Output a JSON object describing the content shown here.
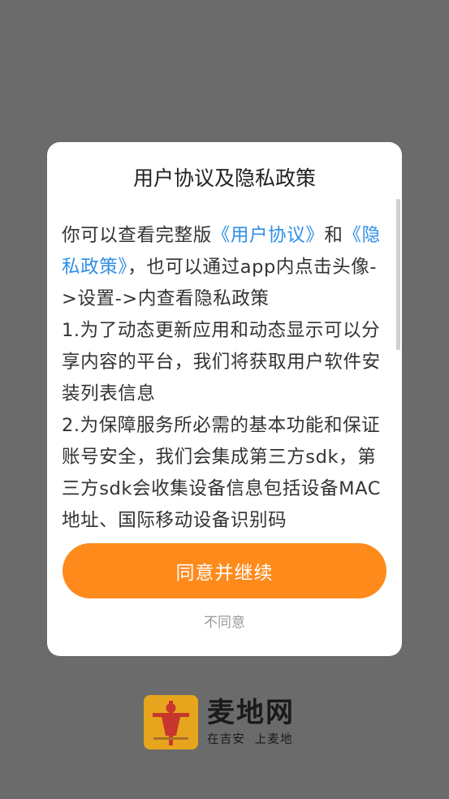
{
  "dialog": {
    "title": "用户协议及隐私政策",
    "intro": {
      "prefix": "你可以查看完整版",
      "user_agreement_link": "《用户协议》",
      "connector": "和",
      "privacy_policy_link": "《隐私政策》",
      "suffix": "，也可以通过app内点击头像->设置->内查看隐私政策"
    },
    "item_1": "1.为了动态更新应用和动态显示可以分享内容的平台，我们将获取用户软件安装列表信息",
    "item_2": "2.为保障服务所必需的基本功能和保证账号安全，我们会集成第三方sdk，第三方sdk会收集设备信息包括设备MAC地址、国际移动设备识别码",
    "agree_label": "同意并继续",
    "disagree_label": "不同意"
  },
  "brand": {
    "name": "麦地网",
    "slogan": "在吉安  上麦地",
    "logo_icon": "scarecrow-logo-icon",
    "logo_color": "#e7a51e",
    "logo_figure_color": "#c8372d"
  },
  "colors": {
    "accent": "#fe8a1c",
    "link": "#2f8ee5",
    "overlay": "#6b6b6b"
  }
}
